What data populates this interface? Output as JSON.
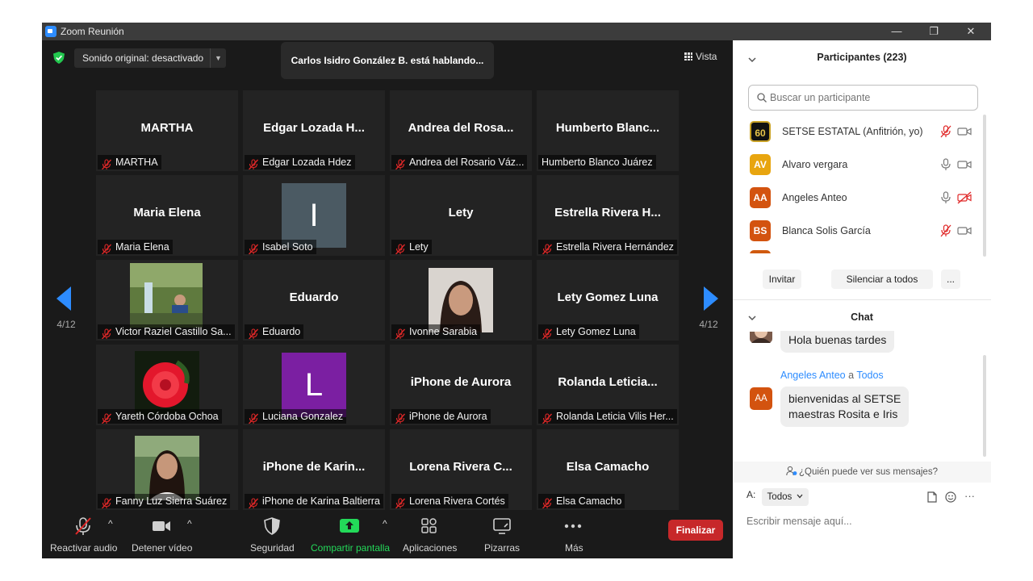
{
  "window": {
    "title": "Zoom Reunión",
    "min": "—",
    "restore": "❐",
    "close": "✕"
  },
  "meeting": {
    "sound_option": "Sonido original: desactivado",
    "dropdown_glyph": "▼",
    "speaking_banner": "Carlos Isidro González B. está hablando...",
    "view_label": "Vista",
    "page_left": "4/12",
    "page_right": "4/12",
    "colors": {
      "accent": "#2d8cff",
      "muted_red": "#e02828",
      "stage_bg": "#1a1a1a",
      "tile_bg": "#232323",
      "share_green": "#23d959",
      "end_red": "#c7282a"
    },
    "tiles": [
      {
        "big": "MARTHA",
        "label": "MARTHA"
      },
      {
        "big": "Edgar  Lozada  H...",
        "label": "Edgar Lozada Hdez"
      },
      {
        "big": "Andrea del Rosa...",
        "label": "Andrea del Rosario Váz..."
      },
      {
        "big": "Humberto  Blanc...",
        "label": "Humberto Blanco Juárez"
      },
      {
        "big": "Maria Elena",
        "label": "Maria Elena"
      },
      {
        "letter": "I",
        "label": "Isabel Soto"
      },
      {
        "big": "Lety",
        "label": "Lety"
      },
      {
        "big": "Estrella Rivera H...",
        "label": "Estrella Rivera Hernández"
      },
      {
        "label": "Victor Raziel Castillo Sa..."
      },
      {
        "big": "Eduardo",
        "label": "Eduardo"
      },
      {
        "label": "Ivonne Sarabia"
      },
      {
        "big": "Lety Gomez Luna",
        "label": "Lety Gomez Luna"
      },
      {
        "label": "Yareth Córdoba Ochoa"
      },
      {
        "letter": "L",
        "label": "Luciana Gonzalez"
      },
      {
        "big": "iPhone de Aurora",
        "label": "iPhone de Aurora"
      },
      {
        "big": "Rolanda  Leticia...",
        "label": "Rolanda Leticia Vilis Her..."
      },
      {
        "label": "Fanny Luz Sierra Suárez"
      },
      {
        "big": "iPhone  de  Karin...",
        "label": "iPhone de Karina Baltierra"
      },
      {
        "big": "Lorena Rivera C...",
        "label": "Lorena Rivera Cortés"
      },
      {
        "big": "Elsa Camacho",
        "label": "Elsa Camacho"
      }
    ]
  },
  "toolbar": {
    "audio": "Reactivar audio",
    "video": "Detener vídeo",
    "security": "Seguridad",
    "share": "Compartir pantalla",
    "apps": "Aplicaciones",
    "whiteboards": "Pizarras",
    "more": "Más",
    "end": "Finalizar",
    "caret": "^"
  },
  "participants": {
    "title": "Participantes (223)",
    "search_placeholder": "Buscar un participante",
    "list": [
      {
        "initials": "60",
        "name": "SETSE ESTATAL (Anfitrión, yo)"
      },
      {
        "initials": "AV",
        "name": "Alvaro vergara"
      },
      {
        "initials": "AA",
        "name": "Angeles Anteo"
      },
      {
        "initials": "BS",
        "name": "Blanca Solis García"
      }
    ],
    "invite": "Invitar",
    "mute_all": "Silenciar a todos",
    "more": "..."
  },
  "chat": {
    "title": "Chat",
    "messages": [
      {
        "text": "Hola buenas tardes"
      },
      {
        "sender": "Angeles Anteo",
        "to_word": "a",
        "recipient": "Todos",
        "initials": "AA",
        "line1": "bienvenidas al SETSE",
        "line2": "maestras Rosita e Iris"
      }
    ],
    "who_sees": "¿Quién puede ver sus mensajes?",
    "to_label": "A:",
    "to_value": "Todos",
    "compose_placeholder": "Escribir mensaje aquí...",
    "more": "···"
  }
}
